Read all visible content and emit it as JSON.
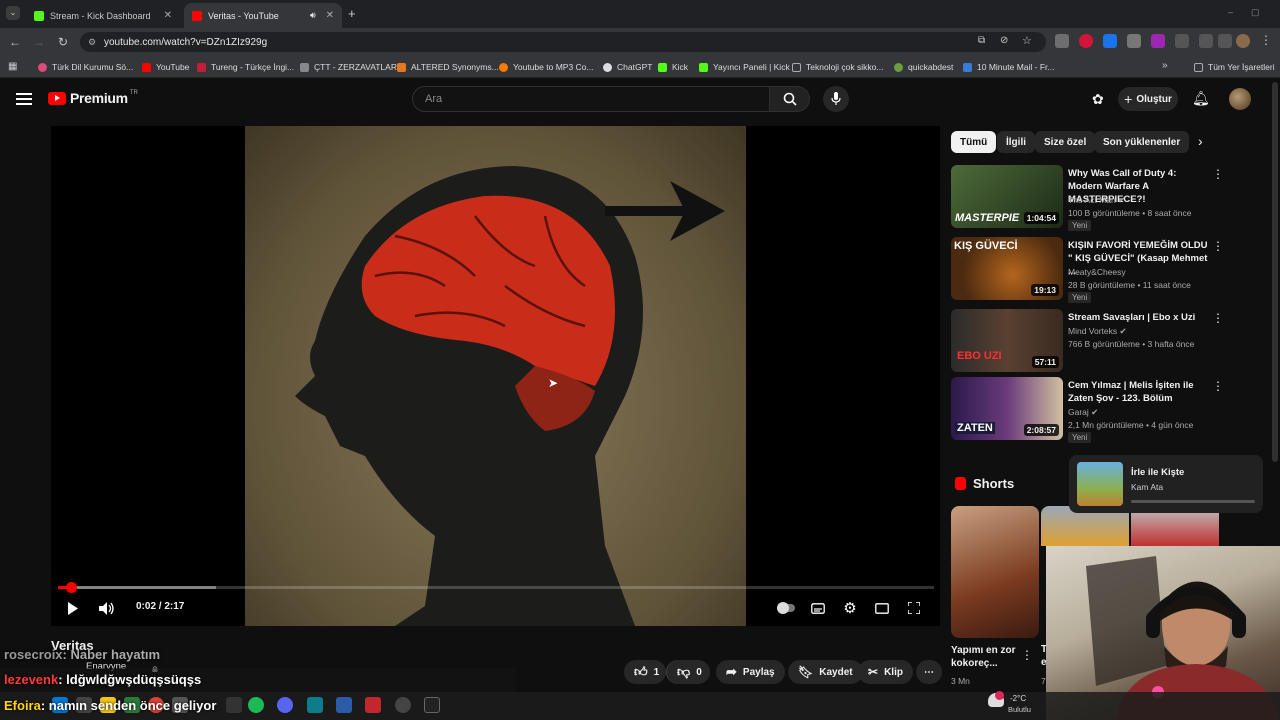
{
  "browser": {
    "tabs": [
      {
        "title": "Stream - Kick Dashboard",
        "color": "#53fc18"
      },
      {
        "title": "Veritas - YouTube",
        "color": "#ff0000"
      }
    ],
    "url": "youtube.com/watch?v=DZn1ZIz929g",
    "bookmarks": [
      "Türk Dil Kurumu Sö...",
      "YouTube",
      "Tureng - Türkçe İngi...",
      "ÇTT - ZERZAVATLAR",
      "ALTERED Synonyms...",
      "Youtube to MP3 Co...",
      "ChatGPT",
      "Kick",
      "Yayıncı Paneli | Kick",
      "Teknoloji çok sikko...",
      "quickabdest",
      "10 Minute Mail - Fr..."
    ],
    "all_bookmarks": "Tüm Yer İşaretleri"
  },
  "yt": {
    "logo": "Premium",
    "logo_region": "TR",
    "search_placeholder": "Ara",
    "create_label": "Oluştur"
  },
  "player": {
    "time": "0:02 / 2:17",
    "progress": 0.015,
    "buffered": 0.18
  },
  "video": {
    "title": "Veritas",
    "likes": "1",
    "dislikes": "0",
    "share": "Paylaş",
    "save": "Kaydet",
    "clip": "Klip"
  },
  "chips": [
    "Tümü",
    "İlgili",
    "Size özel",
    "Son yüklenenler"
  ],
  "recommendations": [
    {
      "title": "Why Was Call of Duty 4: Modern Warfare A MASTERPIECE?!",
      "channel": "The Act Man",
      "meta": "100 B görüntüleme • 8 saat önce",
      "badge": "Yeni",
      "duration": "1:04:54",
      "thumb_text": "MASTERPIE",
      "verified": true
    },
    {
      "title": "KIŞIN FAVORİ YEMEĞİM OLDU \" KIŞ GÜVECİ\" (Kasap Mehmet ...",
      "channel": "Meaty&Cheesy",
      "meta": "28 B görüntüleme • 11 saat önce",
      "badge": "Yeni",
      "duration": "19:13",
      "thumb_text": "KIŞ GÜVECİ",
      "verified": false
    },
    {
      "title": "Stream Savaşları | Ebo x Uzi",
      "channel": "Mind Vorteks",
      "meta": "766 B görüntüleme • 3 hafta önce",
      "badge": "",
      "duration": "57:11",
      "thumb_text": "EBO UZI",
      "verified": true
    },
    {
      "title": "Cem Yılmaz | Melis İşiten ile Zaten Şov - 123. Bölüm",
      "channel": "Garaj",
      "meta": "2,1 Mn görüntüleme • 4 gün önce",
      "badge": "Yeni",
      "duration": "2:08:57",
      "thumb_text": "ZATEN",
      "verified": true
    }
  ],
  "shorts": {
    "heading": "Shorts",
    "first_title": "Yapımı en zor kokoreç...",
    "first_views": "3 Mn",
    "second_title_start": "T",
    "second_title_line2": "e",
    "second_views": "7"
  },
  "miniplayer": {
    "title": "İrle ile Kişte",
    "channel": "Kam Ata"
  },
  "chat": [
    {
      "user": "rosecroix",
      "text": ": Naber hayatım",
      "color": "#c0c0c0"
    },
    {
      "user": "Enarvyne",
      "text": "",
      "color": "#e0e0e0"
    },
    {
      "user": "lezevenk",
      "text": ": ldğwldğwşdüqşsüqşs",
      "color": "#ff3b3b"
    },
    {
      "user": "Efoira",
      "text": ": namın senden önce geliyor",
      "color": "#ffd400"
    }
  ],
  "taskbar": {
    "weather_temp": "-2°C",
    "weather_desc": "Bulutlu"
  }
}
